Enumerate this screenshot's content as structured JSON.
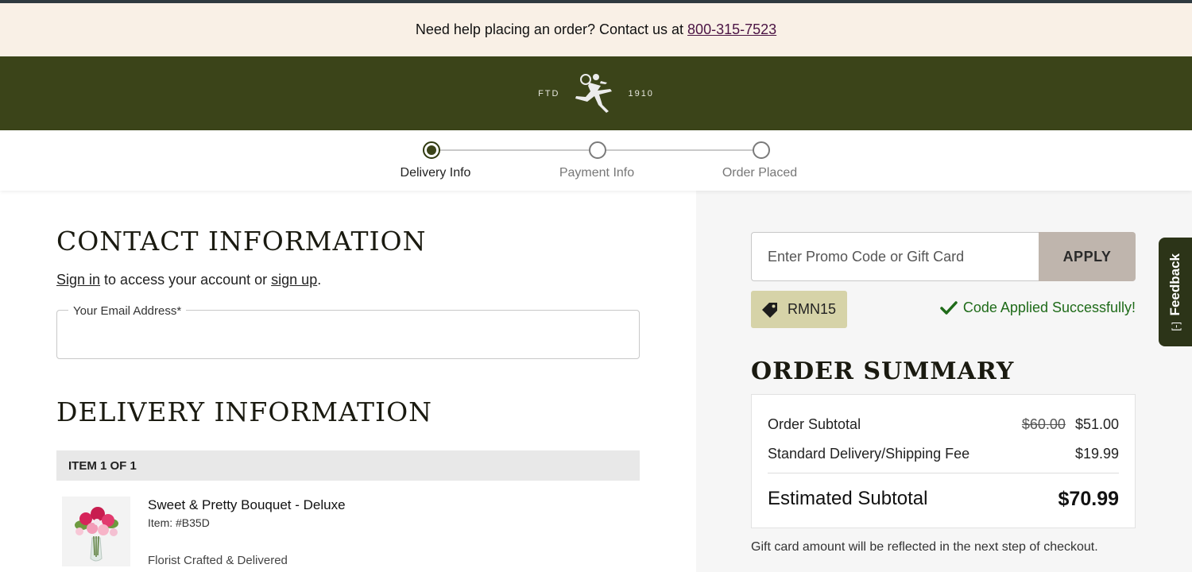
{
  "help_bar": {
    "text": "Need help placing an order? Contact us at",
    "phone": "800-315-7523"
  },
  "brand": {
    "left": "FTD",
    "right": "1910",
    "logo_icon": "mercury-runner-icon"
  },
  "stepper": {
    "steps": [
      {
        "label": "Delivery Info",
        "active": true
      },
      {
        "label": "Payment Info",
        "active": false
      },
      {
        "label": "Order Placed",
        "active": false
      }
    ]
  },
  "contact": {
    "title": "CONTACT INFORMATION",
    "sign_in": "Sign in",
    "middle": " to access your account or ",
    "sign_up": "sign up",
    "period": ".",
    "email_label": "Your Email Address*",
    "email_value": ""
  },
  "delivery": {
    "title": "DELIVERY INFORMATION",
    "item_header": "ITEM 1 OF 1",
    "product_name": "Sweet & Pretty Bouquet - Deluxe",
    "product_id": "Item: #B35D",
    "product_note": "Florist Crafted & Delivered"
  },
  "promo": {
    "placeholder": "Enter Promo Code or Gift Card",
    "apply_label": "APPLY",
    "applied_code": "RMN15",
    "success_text": "Code Applied Successfully!",
    "tag_icon": "tag-icon",
    "check_icon": "check-icon"
  },
  "summary": {
    "title": "ORDER SUMMARY",
    "subtotal_label": "Order Subtotal",
    "subtotal_original": "$60.00",
    "subtotal_value": "$51.00",
    "shipping_label": "Standard Delivery/Shipping Fee",
    "shipping_value": "$19.99",
    "estimated_label": "Estimated Subtotal",
    "estimated_value": "$70.99",
    "gift_note": "Gift card amount will be reflected in the next step of checkout."
  },
  "feedback": {
    "label": "Feedback",
    "mini": "[-]"
  },
  "colors": {
    "brand_green": "#3b4419",
    "help_bg": "#f9f0e6",
    "success_green": "#1f6b19",
    "apply_bg": "#bfb5ad",
    "chip_bg": "#d6d3a8"
  }
}
